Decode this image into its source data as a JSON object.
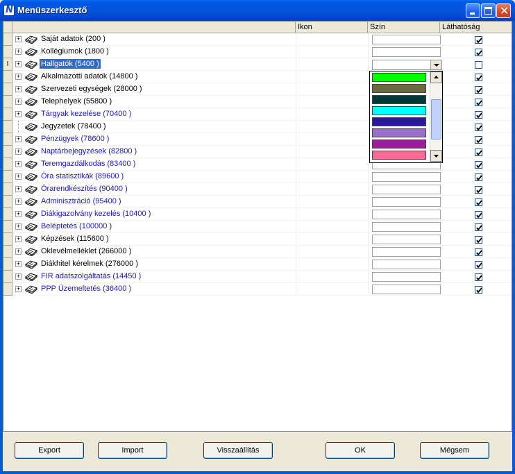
{
  "window": {
    "title": "Menüszerkesztő",
    "app_icon_letter": "N"
  },
  "grid": {
    "columns": {
      "name": "",
      "icon": "Ikon",
      "color": "Szín",
      "visibility": "Láthatóság"
    },
    "rows": [
      {
        "label": "Saját adatok (200  )",
        "blue": false,
        "expandable": true,
        "visible": true
      },
      {
        "label": "Kollégiumok (1800  )",
        "blue": false,
        "expandable": true,
        "visible": true
      },
      {
        "label": "Hallgatók (5400  )",
        "blue": false,
        "expandable": true,
        "visible": false,
        "selected": true
      },
      {
        "label": "Alkalmazotti adatok (14800  )",
        "blue": false,
        "expandable": true,
        "visible": true
      },
      {
        "label": "Szervezeti egységek (28000  )",
        "blue": false,
        "expandable": true,
        "visible": true
      },
      {
        "label": "Telephelyek (55800  )",
        "blue": false,
        "expandable": true,
        "visible": true
      },
      {
        "label": "Tárgyak kezelése (70400  )",
        "blue": true,
        "expandable": true,
        "visible": true
      },
      {
        "label": "Jegyzetek (78400  )",
        "blue": false,
        "expandable": false,
        "visible": true
      },
      {
        "label": "Pénzügyek (78600  )",
        "blue": true,
        "expandable": true,
        "visible": true
      },
      {
        "label": "Naptárbejegyzések (82800  )",
        "blue": true,
        "expandable": true,
        "visible": true
      },
      {
        "label": "Teremgazdálkodás (83400  )",
        "blue": true,
        "expandable": true,
        "visible": true
      },
      {
        "label": "Óra statisztikák (89600  )",
        "blue": true,
        "expandable": true,
        "visible": true
      },
      {
        "label": "Órarendkészítés (90400  )",
        "blue": true,
        "expandable": true,
        "visible": true
      },
      {
        "label": "Adminisztráció (95400  )",
        "blue": true,
        "expandable": true,
        "visible": true
      },
      {
        "label": "Diákigazolvány kezelés (10400  )",
        "blue": true,
        "expandable": true,
        "visible": true
      },
      {
        "label": "Beléptetés (100000  )",
        "blue": true,
        "expandable": true,
        "visible": true
      },
      {
        "label": "Képzések (115600  )",
        "blue": false,
        "expandable": true,
        "visible": true
      },
      {
        "label": "Oklevélmelléklet (266000  )",
        "blue": false,
        "expandable": true,
        "visible": true
      },
      {
        "label": "Diákhitel kérelmek (276000  )",
        "blue": false,
        "expandable": true,
        "visible": true
      },
      {
        "label": "FIR adatszolgáltatás (14450  )",
        "blue": true,
        "expandable": true,
        "visible": true
      },
      {
        "label": "PPP Üzemeltetés (36400  )",
        "blue": true,
        "expandable": true,
        "visible": true
      }
    ],
    "row_indicator": "I"
  },
  "color_dropdown": {
    "options": [
      "#00ff00",
      "#6b6b3f",
      "#003838",
      "#00ffff",
      "#2a1a99",
      "#9b6fc9",
      "#9b1d9b",
      "#f76b96"
    ]
  },
  "buttons": {
    "export": "Export",
    "import": "Import",
    "reset": "Visszaállítás",
    "ok": "OK",
    "cancel": "Mégsem"
  }
}
